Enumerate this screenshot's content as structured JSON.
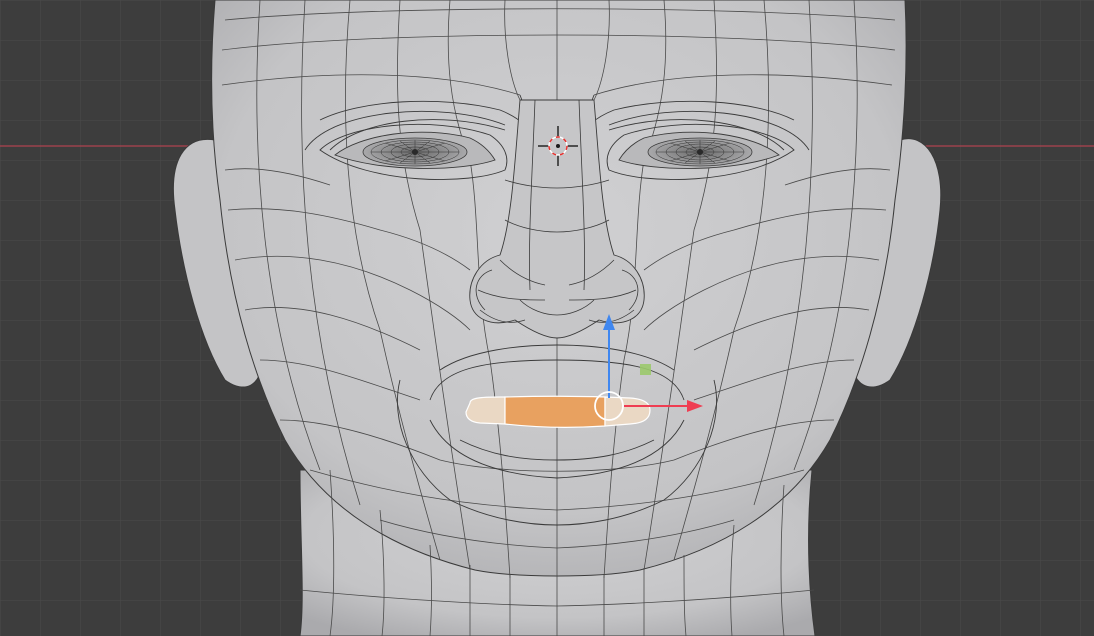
{
  "viewport": {
    "mode": "edit-mode",
    "background_color": "#3d3d3d",
    "grid_color": "#4a4a4a",
    "x_axis_color": "#b0424f"
  },
  "mesh": {
    "object": "head",
    "skin_color": "#c8c8ca",
    "wire_color": "#3a3a3a",
    "selection_color": "#e8a160"
  },
  "gizmo": {
    "x_axis_color": "#ef3d52",
    "z_axis_color": "#3f87f0",
    "plane_handle_color": "#9bc96b",
    "center_ring_color": "#ffffff"
  },
  "cursor_3d": {
    "outer_color": "#ffffff",
    "inner_color": "#e8322f"
  }
}
